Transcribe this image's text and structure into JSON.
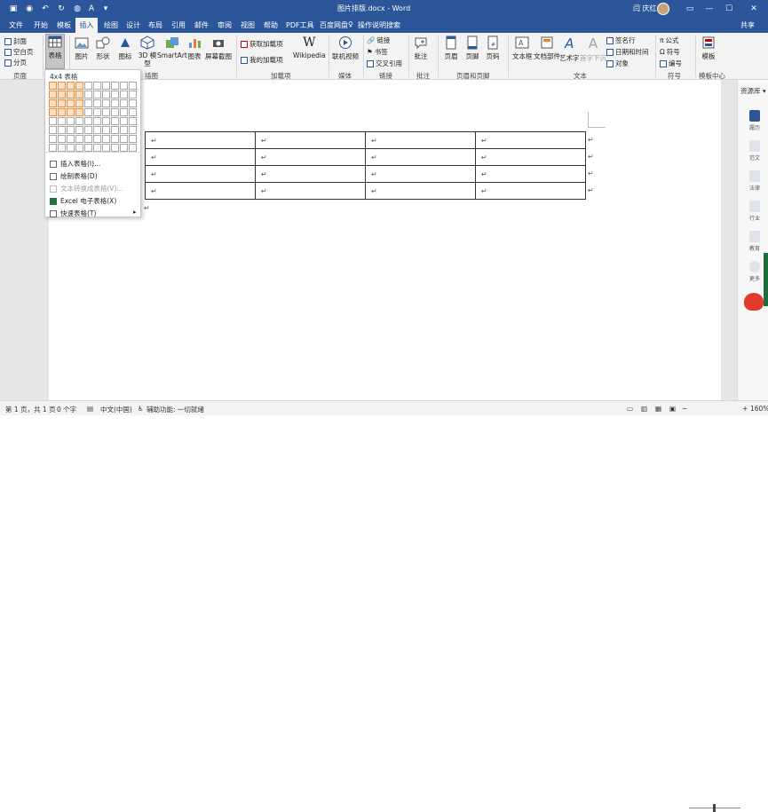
{
  "title_bar": {
    "doc_title": "图片排版.docx - Word",
    "user": "闫 庆红",
    "quick_access": [
      "save-icon",
      "autosave-icon",
      "undo-icon",
      "redo-icon",
      "speech-icon",
      "font-color-icon",
      "customize-icon"
    ]
  },
  "tabs": [
    "文件",
    "开始",
    "模板",
    "插入",
    "绘图",
    "设计",
    "布局",
    "引用",
    "邮件",
    "审阅",
    "视图",
    "帮助",
    "PDF工具",
    "百度网盘"
  ],
  "active_tab": "插入",
  "tell_me": "操作说明搜索",
  "share": "共享",
  "ribbon": {
    "pages_group": {
      "label": "页面",
      "cover": "封面",
      "blank": "空白页",
      "break": "分页"
    },
    "table_group": {
      "table": "表格"
    },
    "illustrations": {
      "label": "插图",
      "picture": "图片",
      "shapes": "形状",
      "icons": "图标",
      "model3d": "3D 模型",
      "smartart": "SmartArt",
      "chart": "图表",
      "screenshot": "屏幕截图"
    },
    "addins": {
      "label": "加载项",
      "get": "获取加载项",
      "my": "我的加载项",
      "wikipedia": "Wikipedia"
    },
    "media": {
      "label": "媒体",
      "video": "联机视频"
    },
    "links": {
      "label": "链接",
      "link": "链接",
      "bookmark": "书签",
      "crossref": "交叉引用"
    },
    "comments": {
      "label": "批注",
      "comment": "批注"
    },
    "header_footer": {
      "label": "页眉和页脚",
      "header": "页眉",
      "footer": "页脚",
      "page_number": "页码"
    },
    "text": {
      "label": "文本",
      "textbox": "文本框",
      "quickparts": "文档部件",
      "wordart": "艺术字",
      "dropcap": "首字下沉",
      "signature": "签名行",
      "datetime": "日期和时间",
      "object": "对象"
    },
    "symbols": {
      "label": "符号",
      "equation": "公式",
      "symbol": "符号",
      "numbering": "编号"
    },
    "template_center": {
      "label": "模板中心",
      "template": "模板"
    }
  },
  "dropdown": {
    "caption": "4x4 表格",
    "grid": {
      "cols": 10,
      "rows": 8,
      "selected_cols": 4,
      "selected_rows": 4
    },
    "items": [
      {
        "label": "插入表格(I)...",
        "disabled": false
      },
      {
        "label": "绘制表格(D)",
        "disabled": false
      },
      {
        "label": "文本转换成表格(V)...",
        "disabled": true
      },
      {
        "label": "Excel 电子表格(X)",
        "disabled": false
      },
      {
        "label": "快速表格(T)",
        "disabled": false,
        "submenu": true
      }
    ]
  },
  "document": {
    "table": {
      "rows": 4,
      "cols": 4,
      "cell_mark": "↵"
    },
    "para_mark": "↵"
  },
  "side_pane": {
    "label": "资源库",
    "items": [
      "履历",
      "范文",
      "法律",
      "行业",
      "教育",
      "更多"
    ]
  },
  "status_bar": {
    "page": "第 1 页，共 1 页",
    "words": "0 个字",
    "language": "中文(中国)",
    "accessibility": "辅助功能: 一切就绪",
    "zoom": "160%"
  },
  "colors": {
    "title_blue": "#2b579a",
    "grid_selected": "#f08c3a",
    "ribbon_bg": "#f3f3f3"
  }
}
